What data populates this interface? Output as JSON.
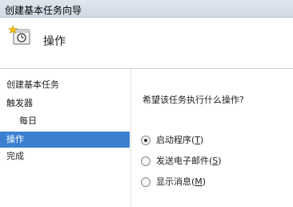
{
  "window": {
    "title": "创建基本任务向导"
  },
  "header": {
    "title": "操作",
    "icon": "task-clock-icon"
  },
  "sidebar": {
    "steps": [
      {
        "label": "创建基本任务"
      },
      {
        "label": "触发器"
      },
      {
        "label": "每日"
      },
      {
        "label": "操作"
      },
      {
        "label": "完成"
      }
    ]
  },
  "main": {
    "prompt": "希望该任务执行什么操作?",
    "options": [
      {
        "text": "启动程序",
        "key": "T",
        "selected": true
      },
      {
        "text": "发送电子邮件",
        "key": "S",
        "selected": false
      },
      {
        "text": "显示消息",
        "key": "M",
        "selected": false
      }
    ]
  },
  "colors": {
    "active_step_bg": "#3a7fd0",
    "active_step_text": "#ffffff"
  }
}
